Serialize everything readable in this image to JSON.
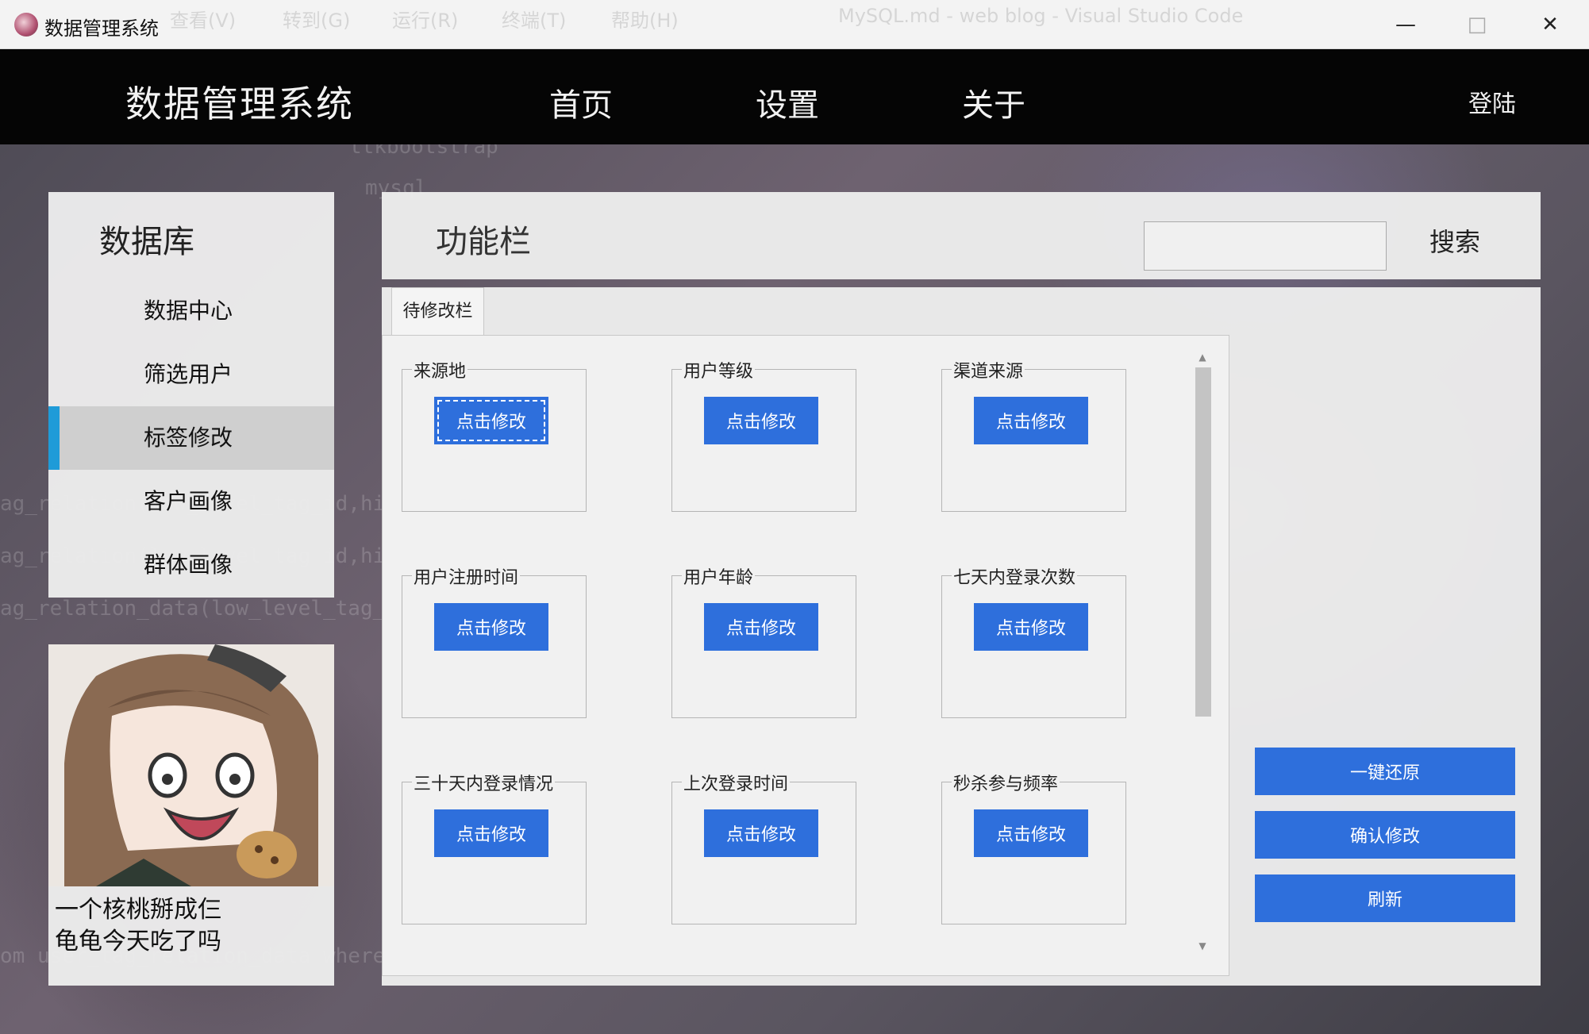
{
  "window": {
    "title": "数据管理系统",
    "background_title": "MySQL.md - web blog - Visual Studio Code",
    "background_menu": [
      "查看(V)",
      "转到(G)",
      "运行(R)",
      "终端(T)",
      "帮助(H)"
    ]
  },
  "navbar": {
    "brand": "数据管理系统",
    "items": [
      "首页",
      "设置",
      "关于"
    ],
    "login": "登陆"
  },
  "sidebar": {
    "title": "数据库",
    "items": [
      {
        "label": "数据中心",
        "active": false
      },
      {
        "label": "筛选用户",
        "active": false
      },
      {
        "label": "标签修改",
        "active": true
      },
      {
        "label": "客户画像",
        "active": false
      },
      {
        "label": "群体画像",
        "active": false
      }
    ]
  },
  "profile": {
    "line1": "一个核桃掰成仨",
    "line2": "龟龟今天吃了吗"
  },
  "function_bar": {
    "title": "功能栏",
    "search_value": "",
    "search_button": "搜索"
  },
  "tab": {
    "label": "待修改栏",
    "button_label": "点击修改",
    "groups": [
      "来源地",
      "用户等级",
      "渠道来源",
      "用户注册时间",
      "用户年龄",
      "七天内登录次数",
      "三十天内登录情况",
      "上次登录时间",
      "秒杀参与频率"
    ]
  },
  "actions": {
    "restore": "一键还原",
    "confirm": "确认修改",
    "refresh": "刷新"
  },
  "colors": {
    "accent": "#2e6fdc",
    "active_indicator": "#1f9bd8",
    "navbar": "#050505"
  }
}
